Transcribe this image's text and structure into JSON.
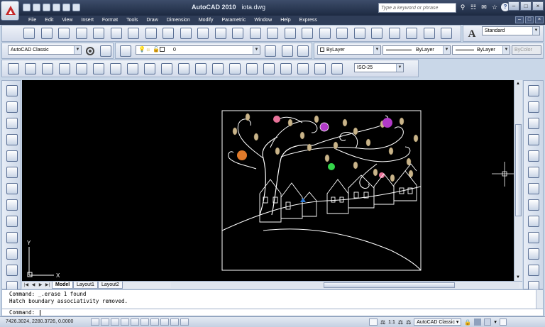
{
  "titlebar": {
    "app_title": "AutoCAD 2010",
    "doc_name": "iota.dwg",
    "search_placeholder": "Type a keyword or phrase"
  },
  "menubar": {
    "items": [
      "File",
      "Edit",
      "View",
      "Insert",
      "Format",
      "Tools",
      "Draw",
      "Dimension",
      "Modify",
      "Parametric",
      "Window",
      "Help",
      "Express"
    ]
  },
  "toolbar": {
    "workspace": "AutoCAD Classic",
    "layer": "0",
    "text_style": "Standard",
    "dim_style": "ISO-25",
    "color": "ByLayer",
    "linetype": "ByLayer",
    "lineweight": "ByLayer",
    "plotstyle": "ByColor"
  },
  "layout_tabs": [
    "Model",
    "Layout1",
    "Layout2"
  ],
  "ucs": {
    "x_label": "X",
    "y_label": "Y"
  },
  "command": {
    "history": [
      "Command: _.erase 1 found",
      "Hatch boundary associativity removed."
    ],
    "prompt": "Command:"
  },
  "statusbar": {
    "coords": "7426.3024, 2280.3726, 0.0000",
    "scale": "1:1",
    "workspace": "AutoCAD Classic"
  },
  "colors": {
    "canvas": "#000000",
    "drawing_lines": "#ffffff",
    "leaf_fill": "#c9b48a",
    "flower_pink": "#e8739a",
    "flower_purple": "#b23ac8",
    "flower_orange": "#e07a2a",
    "flower_green": "#34d64a"
  }
}
